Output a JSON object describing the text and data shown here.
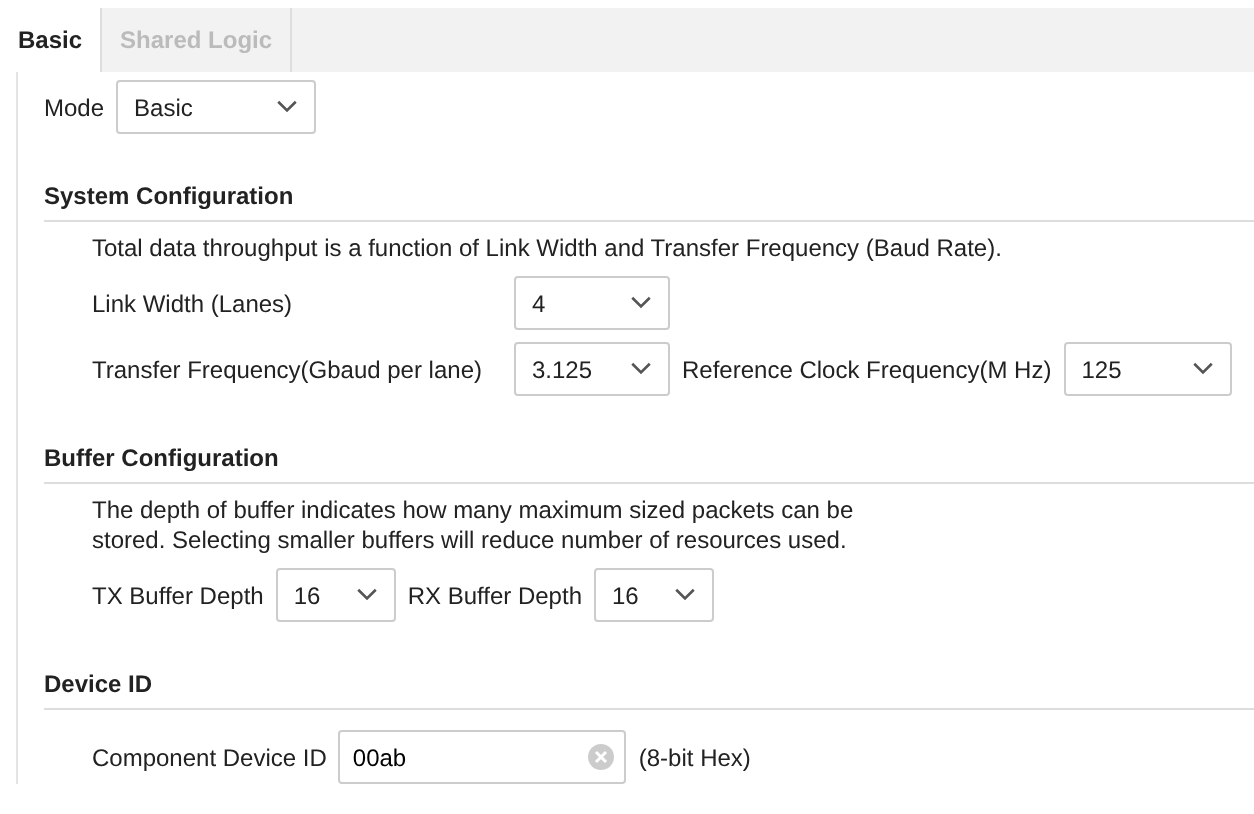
{
  "tabs": [
    {
      "label": "Basic",
      "selected": true
    },
    {
      "label": "Shared Logic",
      "selected": false
    }
  ],
  "mode": {
    "label": "Mode",
    "value": "Basic"
  },
  "sections": [
    {
      "title": "System Configuration",
      "description_lines": [
        "Total data throughput is a function of Link Width and Transfer Frequency (Baud Rate)."
      ],
      "rows": [
        [
          {
            "kind": "select",
            "label": "Link Width (Lanes)",
            "value": "4"
          }
        ],
        [
          {
            "kind": "select",
            "label": "Transfer Frequency(Gbaud per lane)",
            "value": "3.125"
          },
          {
            "kind": "select",
            "label": "Reference Clock Frequency(M Hz)",
            "value": "125"
          }
        ]
      ]
    },
    {
      "title": "Buffer Configuration",
      "description_lines": [
        "The depth of buffer indicates how many maximum sized packets can be",
        "stored. Selecting smaller buffers will reduce number of resources used."
      ],
      "rows": [
        [
          {
            "kind": "select",
            "label": "TX Buffer Depth",
            "value": "16"
          },
          {
            "kind": "select",
            "label": "RX Buffer Depth",
            "value": "16"
          }
        ]
      ]
    },
    {
      "title": "Device ID",
      "rows": [
        [
          {
            "kind": "text",
            "label": "Component Device ID",
            "value": "00ab",
            "suffix": "(8-bit Hex)"
          }
        ]
      ]
    }
  ]
}
